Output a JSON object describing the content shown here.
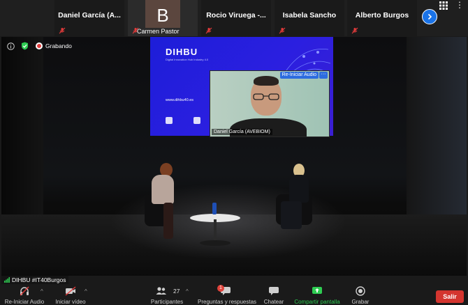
{
  "participants": [
    {
      "name": "Daniel García (A...",
      "muted": true
    },
    {
      "name": "Carmen Pastor",
      "initial": "B",
      "muted": true
    },
    {
      "name": "Rocio Viruega -...",
      "muted": true
    },
    {
      "name": "Isabela Sancho",
      "muted": true
    },
    {
      "name": "Alberto Burgos",
      "muted": true
    }
  ],
  "recording": {
    "label": "Grabando"
  },
  "projection": {
    "logo": "DIHBU",
    "subtitle": "Digital Innovation Hub Industry 4.0",
    "url": "www.dihbu40.es"
  },
  "video": {
    "button": "Re-Iniciar Audio",
    "more": "···",
    "label": "Daniel García (AVEBIOM)"
  },
  "name_tag": "DIHBU #IT40Burgos",
  "toolbar": {
    "audio": "Re-Iniciar Audio",
    "video": "Iniciar vídeo",
    "participants": "Participantes",
    "participants_count": "27",
    "qa": "Preguntas y respuestas",
    "qa_badge": "1",
    "chat": "Chatear",
    "share": "Compartir pantalla",
    "record": "Grabar",
    "leave": "Salir"
  },
  "colors": {
    "leave": "#d4352f",
    "share": "#2ecc52",
    "accent": "#1a73e8",
    "projection": "#2b1fe0"
  }
}
